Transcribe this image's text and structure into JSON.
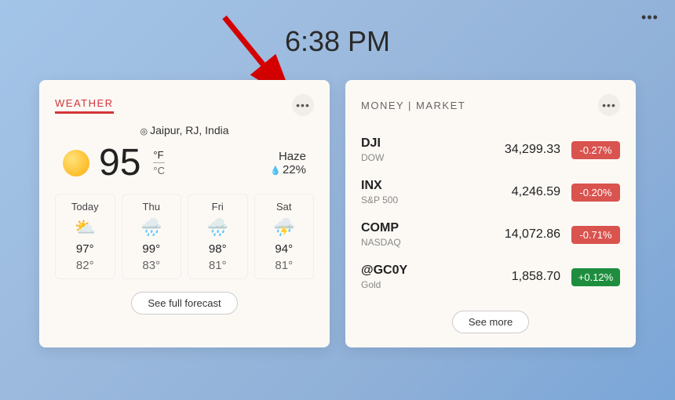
{
  "clock": "6:38 PM",
  "weather": {
    "title": "WEATHER",
    "location": "Jaipur, RJ, India",
    "temp": "95",
    "unit_f": "°F",
    "unit_c": "°C",
    "condition": "Haze",
    "humidity": "22%",
    "forecast": [
      {
        "name": "Today",
        "icon": "⛅",
        "hi": "97°",
        "lo": "82°"
      },
      {
        "name": "Thu",
        "icon": "🌧️",
        "hi": "99°",
        "lo": "83°"
      },
      {
        "name": "Fri",
        "icon": "🌧️",
        "hi": "98°",
        "lo": "81°"
      },
      {
        "name": "Sat",
        "icon": "⛈️",
        "hi": "94°",
        "lo": "81°"
      }
    ],
    "see_more": "See full forecast"
  },
  "money": {
    "title": "MONEY | MARKET",
    "tickers": [
      {
        "sym": "DJI",
        "sub": "DOW",
        "price": "34,299.33",
        "change": "-0.27%",
        "dir": "down"
      },
      {
        "sym": "INX",
        "sub": "S&P 500",
        "price": "4,246.59",
        "change": "-0.20%",
        "dir": "down"
      },
      {
        "sym": "COMP",
        "sub": "NASDAQ",
        "price": "14,072.86",
        "change": "-0.71%",
        "dir": "down"
      },
      {
        "sym": "@GC0Y",
        "sub": "Gold",
        "price": "1,858.70",
        "change": "+0.12%",
        "dir": "up"
      }
    ],
    "see_more": "See more"
  }
}
